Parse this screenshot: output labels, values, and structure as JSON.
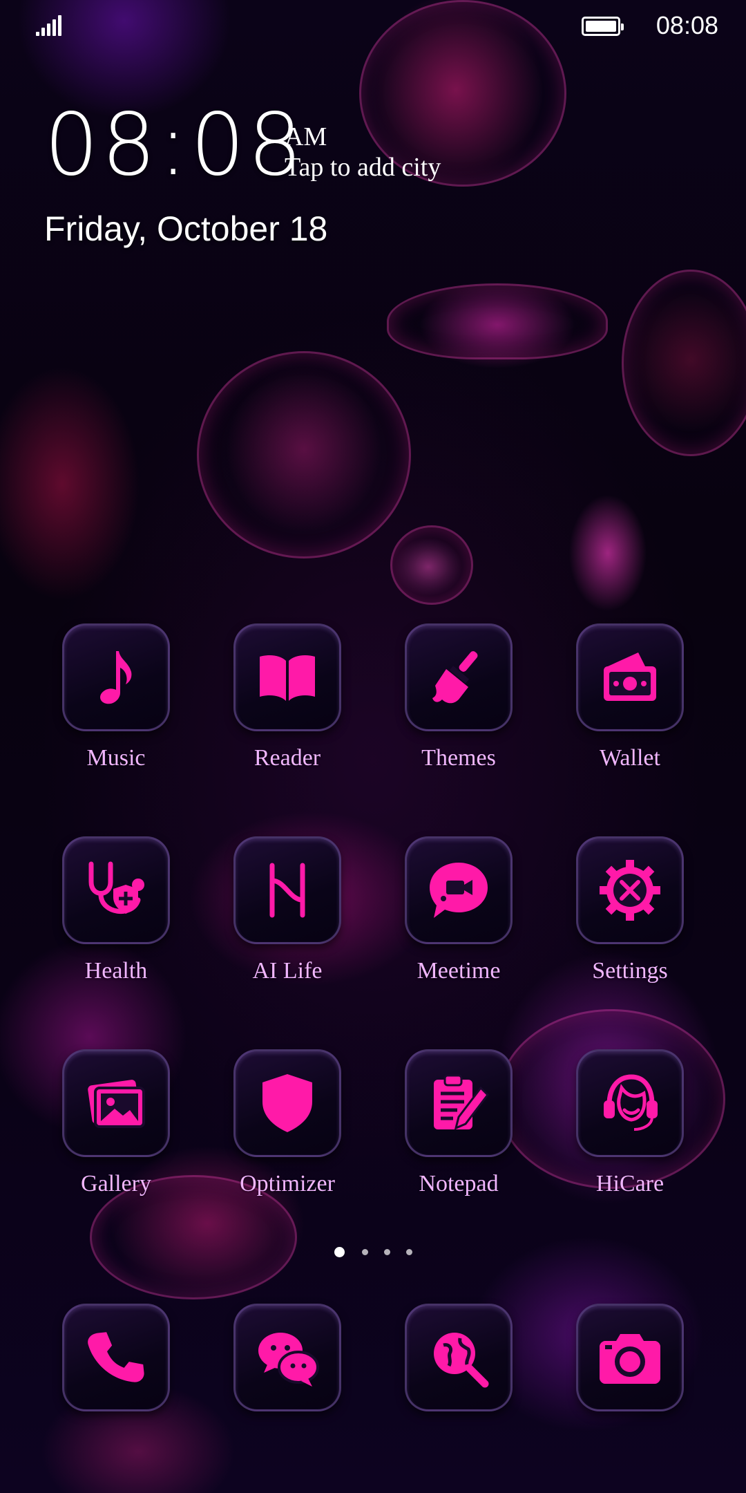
{
  "status_bar": {
    "time": "08:08",
    "battery_icon": "battery-full-icon",
    "signal_icon": "signal-icon"
  },
  "clock_widget": {
    "time": "08:08",
    "ampm": "AM",
    "city_prompt": "Tap to add city",
    "date": "Friday, October 18"
  },
  "accent_color": "#ff1aa8",
  "label_color": "#f1b6ff",
  "apps": [
    {
      "label": "Music",
      "icon": "music-note-icon"
    },
    {
      "label": "Reader",
      "icon": "open-book-icon"
    },
    {
      "label": "Themes",
      "icon": "paintbrush-icon"
    },
    {
      "label": "Wallet",
      "icon": "wallet-icon"
    },
    {
      "label": "Health",
      "icon": "stethoscope-icon"
    },
    {
      "label": "AI Life",
      "icon": "ai-life-icon"
    },
    {
      "label": "Meetime",
      "icon": "video-chat-icon"
    },
    {
      "label": "Settings",
      "icon": "gear-tools-icon"
    },
    {
      "label": "Gallery",
      "icon": "image-icon"
    },
    {
      "label": "Optimizer",
      "icon": "shield-icon"
    },
    {
      "label": "Notepad",
      "icon": "clipboard-pencil-icon"
    },
    {
      "label": "HiCare",
      "icon": "headset-icon"
    }
  ],
  "page_indicator": {
    "pages": 4,
    "current": 1
  },
  "dock": [
    {
      "icon": "phone-icon"
    },
    {
      "icon": "chat-bubbles-icon"
    },
    {
      "icon": "browser-search-icon"
    },
    {
      "icon": "camera-icon"
    }
  ]
}
